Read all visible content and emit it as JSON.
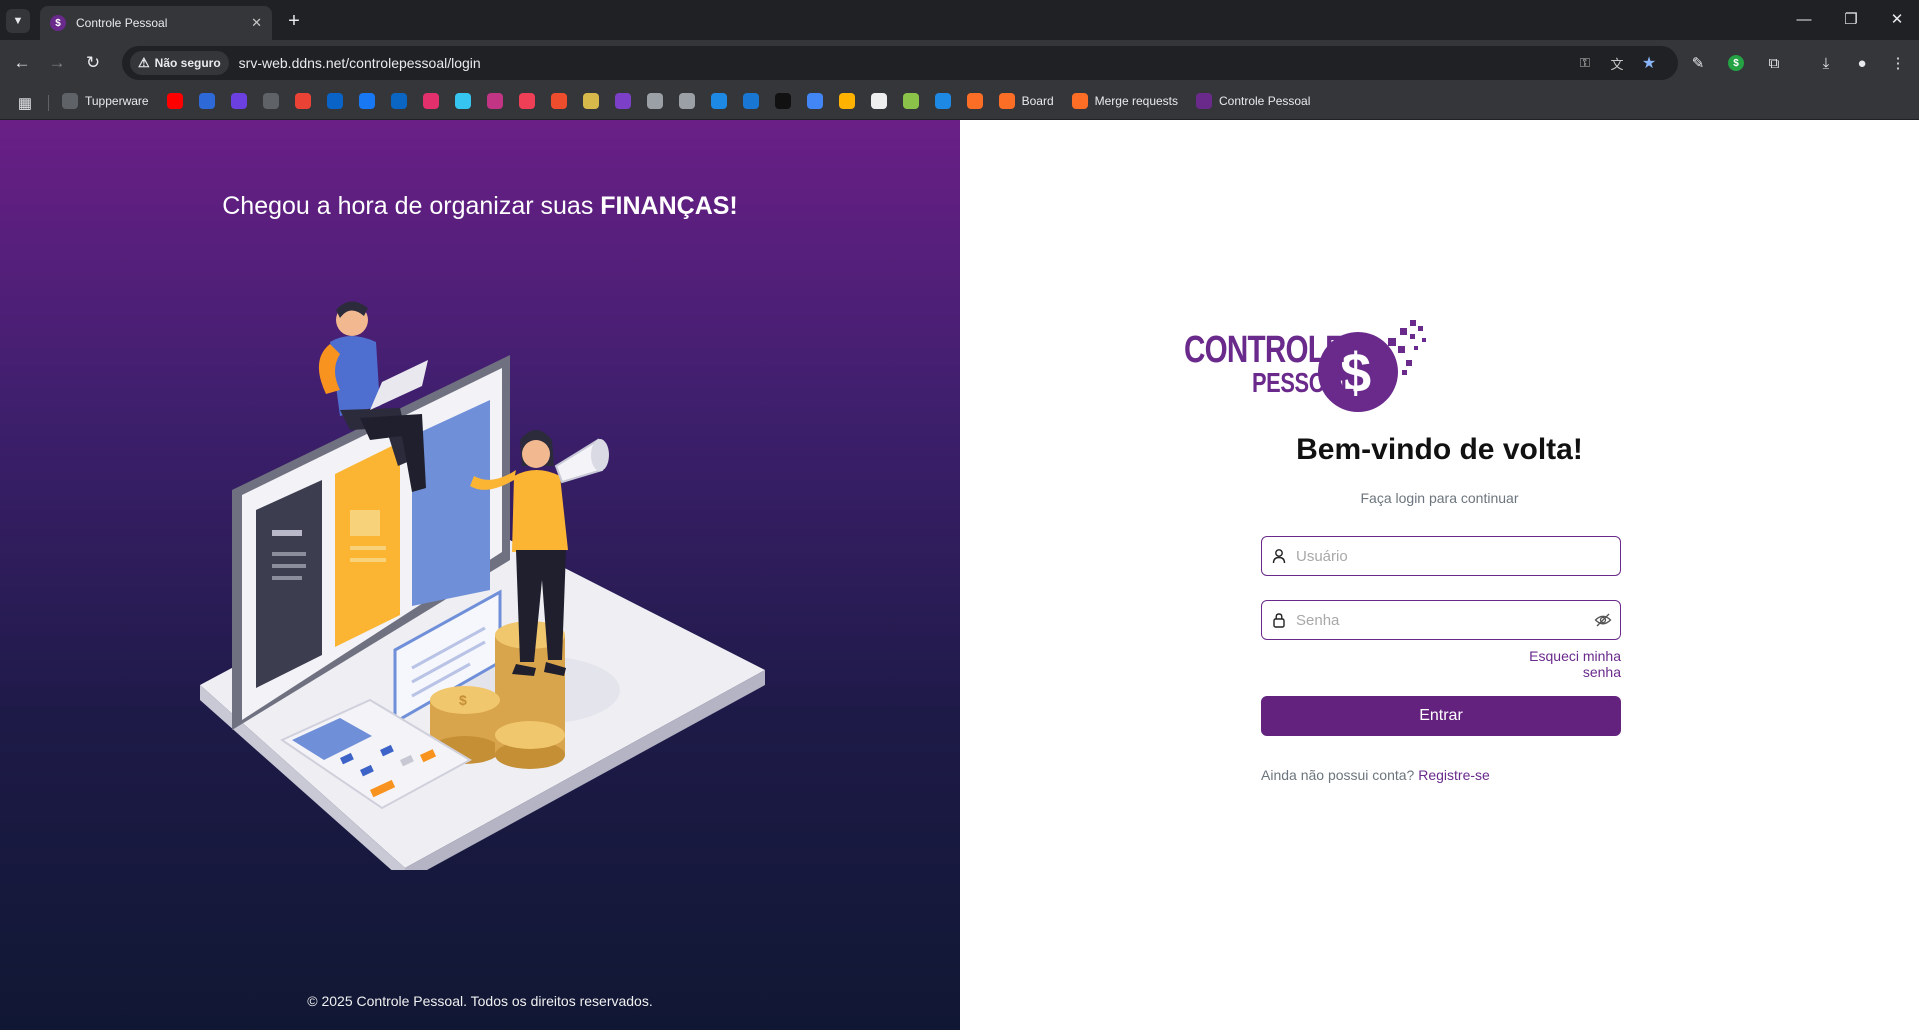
{
  "browser": {
    "tab_title": "Controle Pessoal",
    "tab_favicon": "$",
    "security_label": "Não seguro",
    "url": "srv-web.ddns.net/controlepessoal/login",
    "bookmarks": [
      {
        "label": "Tupperware",
        "icon": "globe-icon",
        "color": "#5f6368"
      },
      {
        "icon": "youtube-icon",
        "color": "#ff0000"
      },
      {
        "icon": "d-icon",
        "color": "#2d6ad8"
      },
      {
        "icon": "chart-icon",
        "color": "#6c3fe0"
      },
      {
        "icon": "globe-icon",
        "color": "#5f6368"
      },
      {
        "icon": "gmail-icon",
        "color": "#ea4335"
      },
      {
        "icon": "outlook-icon",
        "color": "#0a64c8"
      },
      {
        "icon": "facebook-icon",
        "color": "#1877f2"
      },
      {
        "icon": "linkedin-icon",
        "color": "#0a66c2"
      },
      {
        "icon": "instagram-icon",
        "color": "#e1306c"
      },
      {
        "icon": "slack-icon",
        "color": "#36c5f0"
      },
      {
        "icon": "play-icon",
        "color": "#c13584"
      },
      {
        "icon": "pocket-icon",
        "color": "#ef3f56"
      },
      {
        "icon": "shopee-icon",
        "color": "#ee4d2d"
      },
      {
        "icon": "ring-icon",
        "color": "#d6b94a"
      },
      {
        "icon": "shield-icon",
        "color": "#7b3fc8"
      },
      {
        "icon": "openai-icon",
        "color": "#9aa0a6"
      },
      {
        "icon": "apple-icon",
        "color": "#9aa0a6"
      },
      {
        "icon": "drop-icon",
        "color": "#1e88e5"
      },
      {
        "icon": "edge-icon",
        "color": "#1976d2"
      },
      {
        "icon": "l-icon",
        "color": "#111111"
      },
      {
        "icon": "notes-icon",
        "color": "#4285f4"
      },
      {
        "icon": "playstore-icon",
        "color": "#ffb300"
      },
      {
        "icon": "github-icon",
        "color": "#eeeeee"
      },
      {
        "icon": "z-icon",
        "color": "#8bc34a"
      },
      {
        "icon": "puzzle-icon",
        "color": "#1e88e5"
      },
      {
        "icon": "gitlab-icon",
        "color": "#fc6d26"
      },
      {
        "label": "Board",
        "icon": "gitlab-icon",
        "color": "#fc6d26"
      },
      {
        "label": "Merge requests",
        "icon": "gitlab-icon",
        "color": "#fc6d26"
      },
      {
        "label": "Controle Pessoal",
        "icon": "dollar-icon",
        "color": "#6a2a8c"
      }
    ]
  },
  "hero": {
    "title_part": "Chegou a hora de organizar suas ",
    "title_emphasis": "FINANÇAS!",
    "copyright": "© 2025 Controle Pessoal. Todos os direitos reservados."
  },
  "login": {
    "logo_line1": "CONTROLE",
    "logo_line2": "PESSOAL",
    "heading": "Bem-vindo de volta!",
    "subtitle": "Faça login para continuar",
    "username_placeholder": "Usuário",
    "username_value": "",
    "password_placeholder": "Senha",
    "password_value": "",
    "forgot_label": "Esqueci minha senha",
    "submit_label": "Entrar",
    "no_account_text": "Ainda não possui conta? ",
    "register_label": "Registre-se"
  },
  "colors": {
    "brand": "#6a2a8c",
    "button": "#64227f",
    "left_gradient_top": "#6a1f87",
    "left_gradient_bottom": "#101733"
  }
}
